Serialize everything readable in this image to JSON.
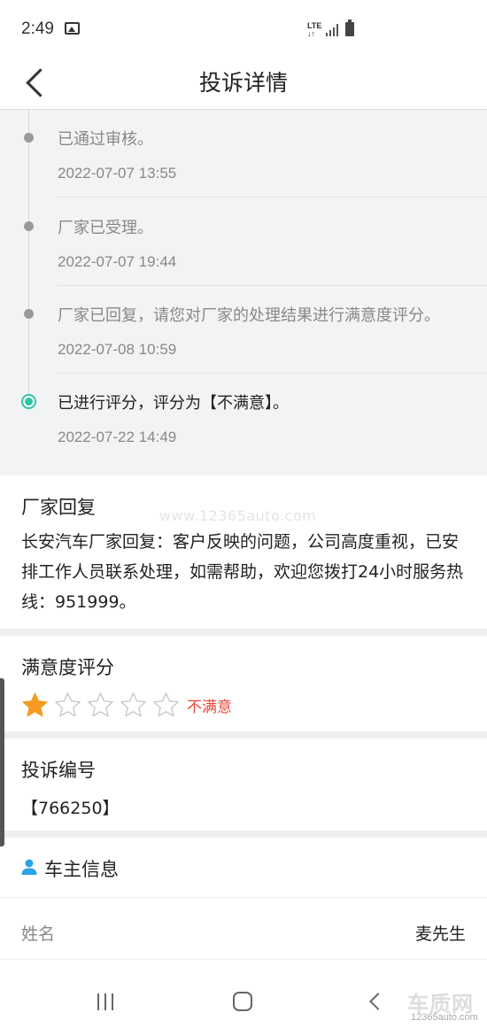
{
  "status_bar": {
    "time": "2:49",
    "network": "LTE"
  },
  "header": {
    "title": "投诉详情"
  },
  "timeline": [
    {
      "text": "已通过审核。",
      "time": "2022-07-07 13:55",
      "active": false
    },
    {
      "text": "厂家已受理。",
      "time": "2022-07-07 19:44",
      "active": false
    },
    {
      "text": "厂家已回复，请您对厂家的处理结果进行满意度评分。",
      "time": "2022-07-08 10:59",
      "active": false
    },
    {
      "text": "已进行评分，评分为【不满意】。",
      "time": "2022-07-22 14:49",
      "active": true
    }
  ],
  "reply": {
    "title": "厂家回复",
    "body": "长安汽车厂家回复：客户反映的问题，公司高度重视，已安排工作人员联系处理，如需帮助，欢迎您拨打24小时服务热线：951999。",
    "watermark": "www.12365auto.com"
  },
  "rating": {
    "title": "满意度评分",
    "stars_filled": 1,
    "stars_total": 5,
    "label": "不满意",
    "star_color": "#f59a23",
    "label_color": "#e8443a"
  },
  "complaint": {
    "title": "投诉编号",
    "number": "【766250】"
  },
  "owner": {
    "title": "车主信息",
    "name_label": "姓名",
    "name_value": "麦先生"
  },
  "logo": {
    "text": "车质网",
    "sub": "12365auto.com"
  },
  "colors": {
    "accent": "#2ec5a5",
    "timeline_bg": "#f2f3f5",
    "owner_icon": "#2aa4e8"
  }
}
